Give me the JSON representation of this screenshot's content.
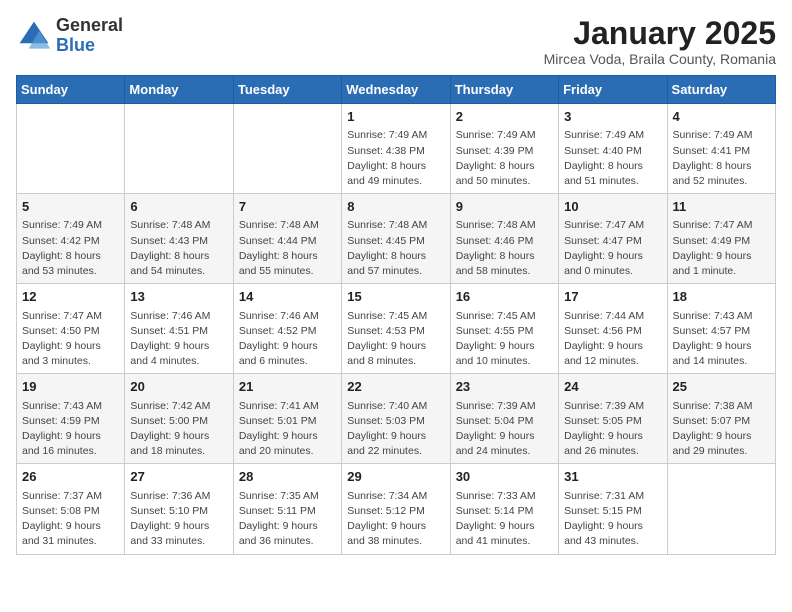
{
  "header": {
    "logo_line1": "General",
    "logo_line2": "Blue",
    "title": "January 2025",
    "subtitle": "Mircea Voda, Braila County, Romania"
  },
  "weekdays": [
    "Sunday",
    "Monday",
    "Tuesday",
    "Wednesday",
    "Thursday",
    "Friday",
    "Saturday"
  ],
  "weeks": [
    [
      {
        "day": "",
        "content": ""
      },
      {
        "day": "",
        "content": ""
      },
      {
        "day": "",
        "content": ""
      },
      {
        "day": "1",
        "content": "Sunrise: 7:49 AM\nSunset: 4:38 PM\nDaylight: 8 hours and 49 minutes."
      },
      {
        "day": "2",
        "content": "Sunrise: 7:49 AM\nSunset: 4:39 PM\nDaylight: 8 hours and 50 minutes."
      },
      {
        "day": "3",
        "content": "Sunrise: 7:49 AM\nSunset: 4:40 PM\nDaylight: 8 hours and 51 minutes."
      },
      {
        "day": "4",
        "content": "Sunrise: 7:49 AM\nSunset: 4:41 PM\nDaylight: 8 hours and 52 minutes."
      }
    ],
    [
      {
        "day": "5",
        "content": "Sunrise: 7:49 AM\nSunset: 4:42 PM\nDaylight: 8 hours and 53 minutes."
      },
      {
        "day": "6",
        "content": "Sunrise: 7:48 AM\nSunset: 4:43 PM\nDaylight: 8 hours and 54 minutes."
      },
      {
        "day": "7",
        "content": "Sunrise: 7:48 AM\nSunset: 4:44 PM\nDaylight: 8 hours and 55 minutes."
      },
      {
        "day": "8",
        "content": "Sunrise: 7:48 AM\nSunset: 4:45 PM\nDaylight: 8 hours and 57 minutes."
      },
      {
        "day": "9",
        "content": "Sunrise: 7:48 AM\nSunset: 4:46 PM\nDaylight: 8 hours and 58 minutes."
      },
      {
        "day": "10",
        "content": "Sunrise: 7:47 AM\nSunset: 4:47 PM\nDaylight: 9 hours and 0 minutes."
      },
      {
        "day": "11",
        "content": "Sunrise: 7:47 AM\nSunset: 4:49 PM\nDaylight: 9 hours and 1 minute."
      }
    ],
    [
      {
        "day": "12",
        "content": "Sunrise: 7:47 AM\nSunset: 4:50 PM\nDaylight: 9 hours and 3 minutes."
      },
      {
        "day": "13",
        "content": "Sunrise: 7:46 AM\nSunset: 4:51 PM\nDaylight: 9 hours and 4 minutes."
      },
      {
        "day": "14",
        "content": "Sunrise: 7:46 AM\nSunset: 4:52 PM\nDaylight: 9 hours and 6 minutes."
      },
      {
        "day": "15",
        "content": "Sunrise: 7:45 AM\nSunset: 4:53 PM\nDaylight: 9 hours and 8 minutes."
      },
      {
        "day": "16",
        "content": "Sunrise: 7:45 AM\nSunset: 4:55 PM\nDaylight: 9 hours and 10 minutes."
      },
      {
        "day": "17",
        "content": "Sunrise: 7:44 AM\nSunset: 4:56 PM\nDaylight: 9 hours and 12 minutes."
      },
      {
        "day": "18",
        "content": "Sunrise: 7:43 AM\nSunset: 4:57 PM\nDaylight: 9 hours and 14 minutes."
      }
    ],
    [
      {
        "day": "19",
        "content": "Sunrise: 7:43 AM\nSunset: 4:59 PM\nDaylight: 9 hours and 16 minutes."
      },
      {
        "day": "20",
        "content": "Sunrise: 7:42 AM\nSunset: 5:00 PM\nDaylight: 9 hours and 18 minutes."
      },
      {
        "day": "21",
        "content": "Sunrise: 7:41 AM\nSunset: 5:01 PM\nDaylight: 9 hours and 20 minutes."
      },
      {
        "day": "22",
        "content": "Sunrise: 7:40 AM\nSunset: 5:03 PM\nDaylight: 9 hours and 22 minutes."
      },
      {
        "day": "23",
        "content": "Sunrise: 7:39 AM\nSunset: 5:04 PM\nDaylight: 9 hours and 24 minutes."
      },
      {
        "day": "24",
        "content": "Sunrise: 7:39 AM\nSunset: 5:05 PM\nDaylight: 9 hours and 26 minutes."
      },
      {
        "day": "25",
        "content": "Sunrise: 7:38 AM\nSunset: 5:07 PM\nDaylight: 9 hours and 29 minutes."
      }
    ],
    [
      {
        "day": "26",
        "content": "Sunrise: 7:37 AM\nSunset: 5:08 PM\nDaylight: 9 hours and 31 minutes."
      },
      {
        "day": "27",
        "content": "Sunrise: 7:36 AM\nSunset: 5:10 PM\nDaylight: 9 hours and 33 minutes."
      },
      {
        "day": "28",
        "content": "Sunrise: 7:35 AM\nSunset: 5:11 PM\nDaylight: 9 hours and 36 minutes."
      },
      {
        "day": "29",
        "content": "Sunrise: 7:34 AM\nSunset: 5:12 PM\nDaylight: 9 hours and 38 minutes."
      },
      {
        "day": "30",
        "content": "Sunrise: 7:33 AM\nSunset: 5:14 PM\nDaylight: 9 hours and 41 minutes."
      },
      {
        "day": "31",
        "content": "Sunrise: 7:31 AM\nSunset: 5:15 PM\nDaylight: 9 hours and 43 minutes."
      },
      {
        "day": "",
        "content": ""
      }
    ]
  ]
}
